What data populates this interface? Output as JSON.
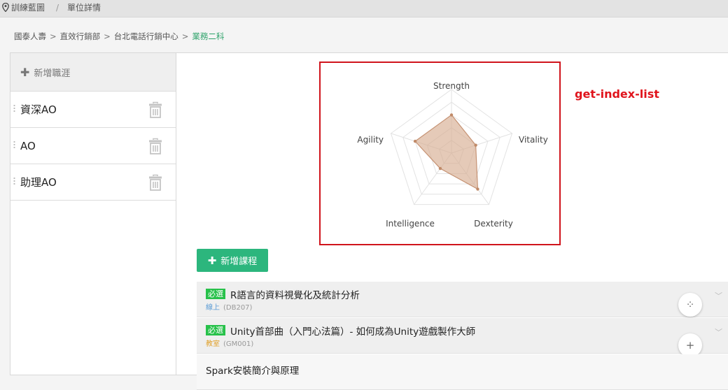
{
  "topbar": {
    "icon": "location-pin-icon",
    "crumb1": "訓練藍圖",
    "separator": "/",
    "crumb2": "單位詳情"
  },
  "org_path": {
    "items": [
      "國泰人壽",
      "直效行銷部",
      "台北電話行銷中心"
    ],
    "current": "業務二科",
    "separator": ">"
  },
  "sidebar": {
    "add_label": "新增職涯",
    "roles": [
      {
        "label": "資深AO"
      },
      {
        "label": "AO"
      },
      {
        "label": "助理AO"
      }
    ]
  },
  "chart_data": {
    "type": "radar",
    "axes": [
      "Strength",
      "Vitality",
      "Dexterity",
      "Intelligence",
      "Agility"
    ],
    "max": 10,
    "levels": 5,
    "series": [
      {
        "values": [
          6,
          4,
          7,
          3,
          6
        ]
      }
    ],
    "colors": {
      "fill": "#d7ad92",
      "stroke": "#c69374",
      "point": "#c08a68",
      "grid": "#e2e2e2"
    }
  },
  "annotation": "get-index-list",
  "add_course_label": "新增課程",
  "courses": [
    {
      "badge": "必選",
      "title": "R語言的資料視覺化及統計分析",
      "mode": "線上",
      "code": "(DB207)",
      "mode_color": "#5a9bd5",
      "action_icon": "collapse-icon",
      "action_glyph": "⁘"
    },
    {
      "badge": "必選",
      "title": "Unity首部曲（入門心法篇）- 如何成為Unity遊戲製作大師",
      "mode": "教室",
      "code": "(GM001)",
      "mode_color": "#e0a12b",
      "action_icon": "plus-icon",
      "action_glyph": "+"
    },
    {
      "title": "Spark安裝簡介與原理"
    }
  ],
  "colors": {
    "accent": "#2cb67d",
    "badge": "#27c14a",
    "highlight_border": "#d0141c"
  }
}
